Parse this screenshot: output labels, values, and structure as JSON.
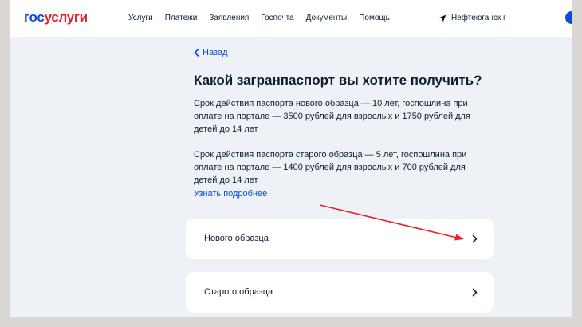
{
  "header": {
    "logo_part1": "гос",
    "logo_part2": "услуги",
    "nav": [
      "Услуги",
      "Платежи",
      "Заявления",
      "Госпочта",
      "Документы",
      "Помощь"
    ],
    "location": "Нефтеюганск г"
  },
  "main": {
    "back_label": "Назад",
    "title": "Какой загранпаспорт вы хотите получить?",
    "paragraph_new": "Срок действия паспорта нового образца — 10 лет, госпошлина при оплате на портале — 3500 рублей для взрослых и 1750 рублей для детей до 14 лет",
    "paragraph_old": "Срок действия паспорта старого образца — 5 лет, госпошлина при оплате на портале — 1400 рублей для взрослых и 700 рублей для детей до 14 лет",
    "more_link": "Узнать подробнее",
    "options": [
      {
        "label": "Нового образца"
      },
      {
        "label": "Старого образца"
      }
    ]
  },
  "colors": {
    "brand_blue": "#0d4cd3",
    "brand_red": "#e4212a",
    "annotation_arrow": "#e8202a"
  },
  "icons": [
    "location-arrow-icon",
    "chevron-left-icon",
    "chevron-right-icon"
  ]
}
